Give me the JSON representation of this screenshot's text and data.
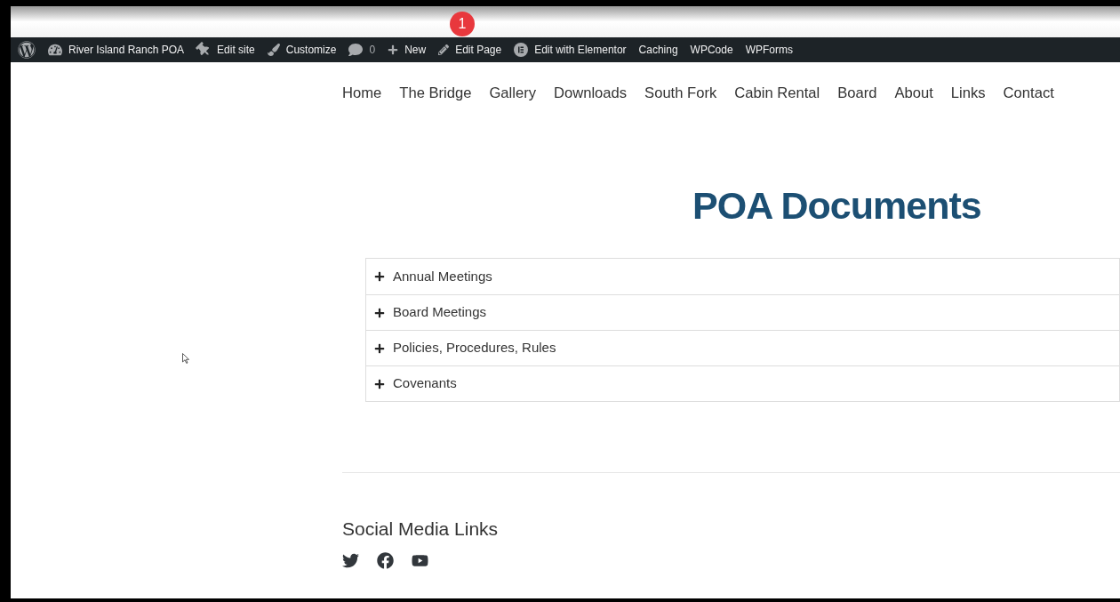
{
  "admin_bar": {
    "items": [
      {
        "kind": "wordpress"
      },
      {
        "kind": "dashboard",
        "label": "River Island Ranch POA"
      },
      {
        "kind": "pin",
        "label": "Edit site"
      },
      {
        "kind": "brush",
        "label": "Customize"
      },
      {
        "kind": "comments",
        "label": "0"
      },
      {
        "kind": "plus",
        "label": "New"
      },
      {
        "kind": "pencil",
        "label": "Edit Page"
      },
      {
        "kind": "elementor",
        "label": "Edit with Elementor"
      },
      {
        "kind": "text",
        "label": "Caching"
      },
      {
        "kind": "text",
        "label": "WPCode"
      },
      {
        "kind": "text",
        "label": "WPForms"
      }
    ]
  },
  "step_badge": "1",
  "nav": {
    "items": [
      "Home",
      "The Bridge",
      "Gallery",
      "Downloads",
      "South Fork",
      "Cabin Rental",
      "Board",
      "About",
      "Links",
      "Contact"
    ]
  },
  "page_title": "POA Documents",
  "accordion": [
    {
      "label": "Annual Meetings",
      "expanded": false
    },
    {
      "label": "Board Meetings",
      "expanded": false
    },
    {
      "label": "Policies, Procedures, Rules",
      "expanded": false
    },
    {
      "label": "Covenants",
      "expanded": false
    }
  ],
  "footer": {
    "heading": "Social Media Links",
    "social": [
      {
        "kind": "twitter"
      },
      {
        "kind": "facebook"
      },
      {
        "kind": "youtube"
      }
    ]
  }
}
